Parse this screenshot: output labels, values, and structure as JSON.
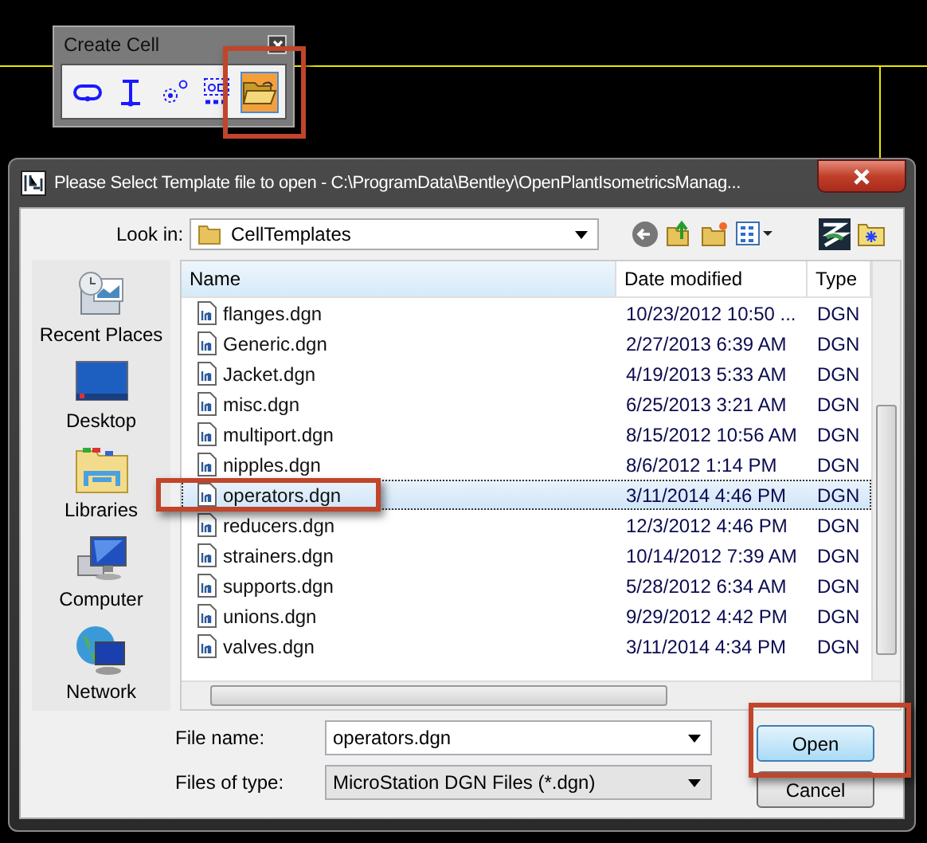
{
  "toolbox": {
    "title": "Create Cell",
    "tools": [
      {
        "kind": "loop",
        "selected": false
      },
      {
        "kind": "beam",
        "selected": false
      },
      {
        "kind": "origin",
        "selected": false
      },
      {
        "kind": "cells",
        "selected": false
      },
      {
        "kind": "folder",
        "selected": true
      }
    ]
  },
  "dialog": {
    "title": "Please Select Template file to open - C:\\ProgramData\\Bentley\\OpenPlantIsometricsManag...",
    "look_in_label": "Look in:",
    "look_in_value": "CellTemplates",
    "places": [
      {
        "label": "Recent Places",
        "kind": "recent"
      },
      {
        "label": "Desktop",
        "kind": "desktop"
      },
      {
        "label": "Libraries",
        "kind": "libraries"
      },
      {
        "label": "Computer",
        "kind": "computer"
      },
      {
        "label": "Network",
        "kind": "network"
      }
    ],
    "columns": [
      "Name",
      "Date modified",
      "Type"
    ],
    "files": [
      {
        "name": "flanges.dgn",
        "date": "10/23/2012 10:50 ...",
        "type": "DGN",
        "selected": false
      },
      {
        "name": "Generic.dgn",
        "date": "2/27/2013 6:39 AM",
        "type": "DGN",
        "selected": false
      },
      {
        "name": "Jacket.dgn",
        "date": "4/19/2013 5:33 AM",
        "type": "DGN",
        "selected": false
      },
      {
        "name": "misc.dgn",
        "date": "6/25/2013 3:21 AM",
        "type": "DGN",
        "selected": false
      },
      {
        "name": "multiport.dgn",
        "date": "8/15/2012 10:56 AM",
        "type": "DGN",
        "selected": false
      },
      {
        "name": "nipples.dgn",
        "date": "8/6/2012 1:14 PM",
        "type": "DGN",
        "selected": false
      },
      {
        "name": "operators.dgn",
        "date": "3/11/2014 4:46 PM",
        "type": "DGN",
        "selected": true
      },
      {
        "name": "reducers.dgn",
        "date": "12/3/2012 4:46 PM",
        "type": "DGN",
        "selected": false
      },
      {
        "name": "strainers.dgn",
        "date": "10/14/2012 7:39 AM",
        "type": "DGN",
        "selected": false
      },
      {
        "name": "supports.dgn",
        "date": "5/28/2012 6:34 AM",
        "type": "DGN",
        "selected": false
      },
      {
        "name": "unions.dgn",
        "date": "9/29/2012 4:42 PM",
        "type": "DGN",
        "selected": false
      },
      {
        "name": "valves.dgn",
        "date": "3/11/2014 4:34 PM",
        "type": "DGN",
        "selected": false
      }
    ],
    "file_name_label": "File name:",
    "file_name_value": "operators.dgn",
    "file_type_label": "Files of type:",
    "file_type_value": "MicroStation DGN Files (*.dgn)",
    "buttons": [
      {
        "label": "Open",
        "kind": "default"
      },
      {
        "label": "Cancel",
        "kind": "normal"
      }
    ]
  }
}
